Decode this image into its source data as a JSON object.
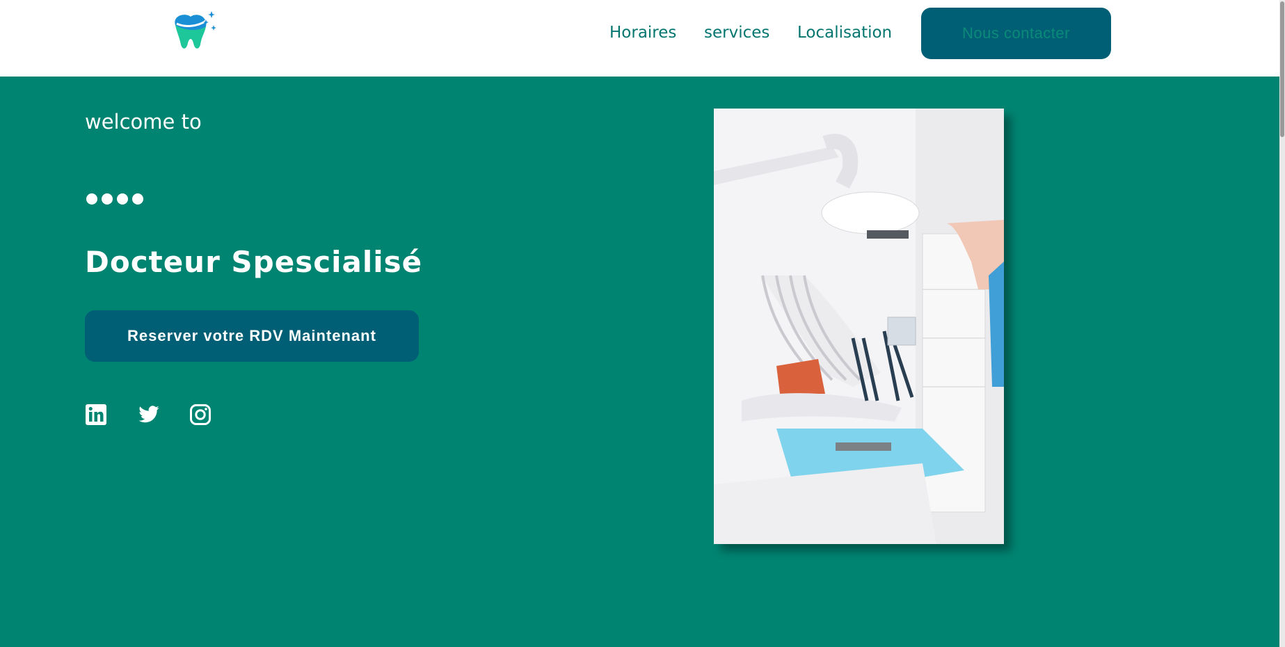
{
  "nav": {
    "items": [
      {
        "label": "Horaires"
      },
      {
        "label": "services"
      },
      {
        "label": "Localisation"
      }
    ],
    "contact_label": "Nous contacter"
  },
  "hero": {
    "welcome": "welcome to",
    "dots": "●●●●",
    "title": "Docteur Spescialisé",
    "cta_label": "Reserver votre RDV Maintenant"
  },
  "socials": [
    {
      "icon": "linkedin-icon"
    },
    {
      "icon": "twitter-icon"
    },
    {
      "icon": "instagram-icon"
    }
  ],
  "colors": {
    "brand": "#008472",
    "button": "#015f75",
    "nav_text": "#05766f"
  }
}
